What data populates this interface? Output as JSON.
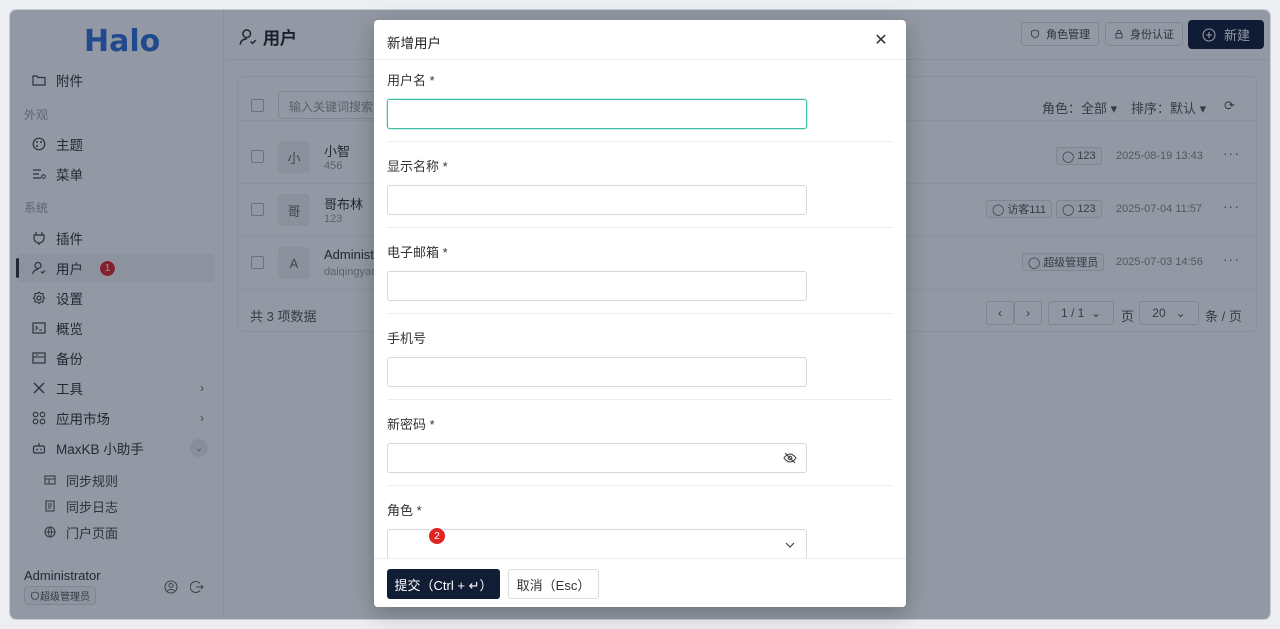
{
  "app": {
    "logo": "Halo"
  },
  "sidebar": {
    "items": [
      {
        "label": "附件",
        "icon": "folder-icon"
      },
      {
        "group": "外观"
      },
      {
        "label": "主题",
        "icon": "palette-icon"
      },
      {
        "label": "菜单",
        "icon": "menu-icon"
      },
      {
        "group": "系统"
      },
      {
        "label": "插件",
        "icon": "plug-icon"
      },
      {
        "label": "用户",
        "icon": "user-icon",
        "badge": "1"
      },
      {
        "label": "设置",
        "icon": "gear-icon"
      },
      {
        "label": "概览",
        "icon": "terminal-icon"
      },
      {
        "label": "备份",
        "icon": "archive-icon"
      },
      {
        "label": "工具",
        "icon": "tools-icon"
      },
      {
        "label": "应用市场",
        "icon": "apps-icon"
      },
      {
        "label": "MaxKB 小助手",
        "icon": "robot-icon"
      }
    ],
    "sub_items": [
      {
        "label": "同步规则",
        "icon": "rules-icon"
      },
      {
        "label": "同步日志",
        "icon": "log-icon"
      },
      {
        "label": "门户页面",
        "icon": "globe-icon"
      }
    ],
    "footer": {
      "name": "Administrator",
      "role": "超级管理员"
    }
  },
  "header": {
    "title": "用户",
    "role_mgmt": "角色管理",
    "auth": "身份认证",
    "new": "新建"
  },
  "list": {
    "search_placeholder": "输入关键词搜索",
    "filter_role": "角色：全部",
    "filter_sort": "排序：默认",
    "rows": [
      {
        "avatar": "小",
        "name": "小智",
        "sub": "456",
        "tags": [
          "123"
        ],
        "date": "2025-08-19 13:43"
      },
      {
        "avatar": "哥",
        "name": "哥布林",
        "sub": "123",
        "tags": [
          "访客111",
          "123"
        ],
        "date": "2025-07-04 11:57"
      },
      {
        "avatar": "A",
        "name": "Administ",
        "sub": "daiqingyao",
        "tags": [
          "超级管理员"
        ],
        "date": "2025-07-03 14:56"
      }
    ],
    "total": "共 3 项数据",
    "page": "1 / 1",
    "page_label": "页",
    "page_size": "20",
    "per_page_label": "条 / 页"
  },
  "modal": {
    "title": "新增用户",
    "fields": {
      "username": "用户名 *",
      "display_name": "显示名称 *",
      "email": "电子邮箱 *",
      "phone": "手机号",
      "password": "新密码 *",
      "role": "角色 *"
    },
    "badge": "2",
    "submit": "提交（Ctrl + ↵）",
    "cancel": "取消（Esc）"
  }
}
